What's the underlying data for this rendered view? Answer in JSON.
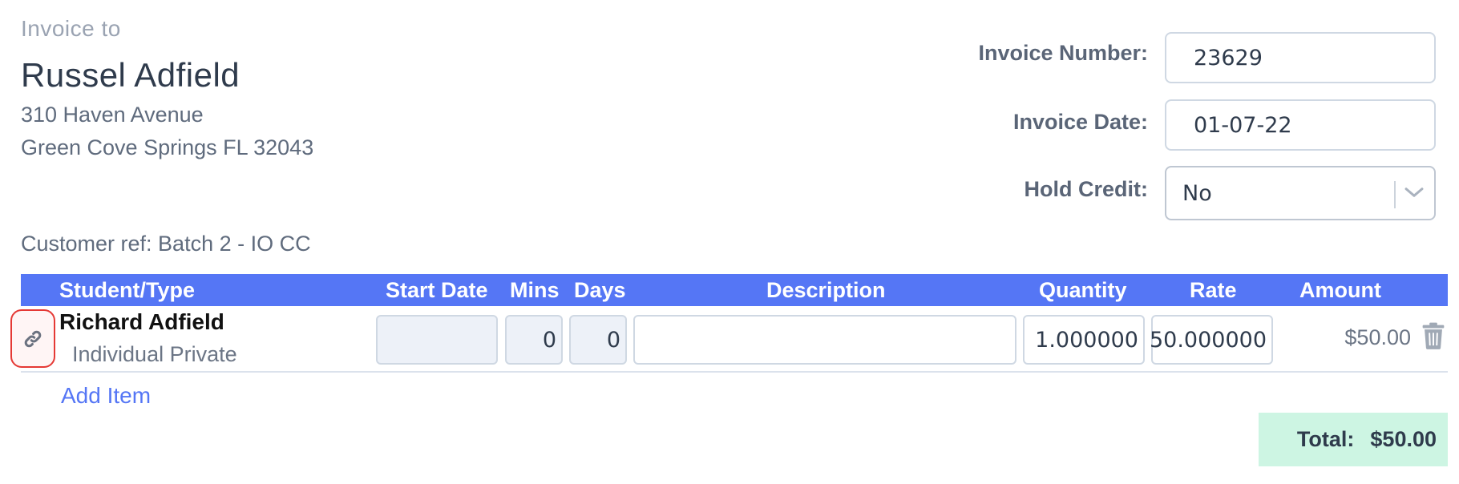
{
  "bill_to": {
    "heading": "Invoice to",
    "name": "Russel Adfield",
    "address_line1": "310 Haven Avenue",
    "address_line2": "Green Cove Springs FL 32043",
    "customer_ref": "Customer ref: Batch 2 - IO CC"
  },
  "fields": {
    "invoice_number_label": "Invoice Number:",
    "invoice_number_value": "23629",
    "invoice_date_label": "Invoice Date:",
    "invoice_date_value": "01-07-22",
    "hold_credit_label": "Hold Credit:",
    "hold_credit_value": "No"
  },
  "table": {
    "headers": {
      "student": "Student/Type",
      "start_date": "Start Date",
      "mins": "Mins",
      "days": "Days",
      "description": "Description",
      "quantity": "Quantity",
      "rate": "Rate",
      "amount": "Amount"
    },
    "rows": [
      {
        "student_name": "Richard Adfield",
        "student_type": "Individual Private",
        "start_date": "",
        "mins": "0",
        "days": "0",
        "description": "",
        "quantity": "1.000000",
        "rate": "50.000000",
        "amount": "$50.00"
      }
    ],
    "add_item_label": "Add Item"
  },
  "totals": {
    "label": "Total:",
    "value": "$50.00"
  },
  "colors": {
    "header_bg": "#5576f5",
    "link_accent": "#5576f5",
    "highlight_border": "#e53935",
    "total_bg": "#cdf5e3"
  },
  "icons": [
    "link-icon",
    "chevron-down-icon",
    "trash-icon"
  ]
}
